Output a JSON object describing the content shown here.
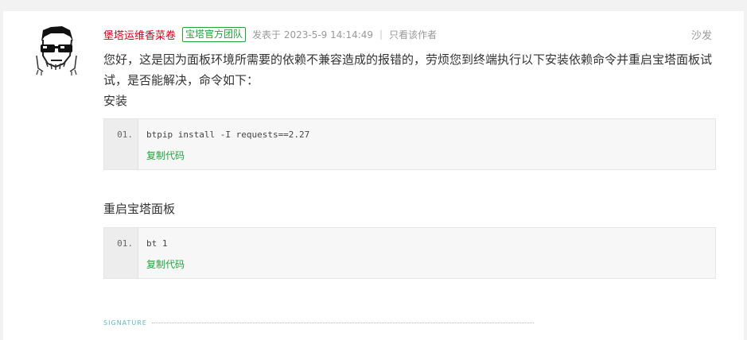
{
  "post": {
    "author": "堡塔运维香菜卷",
    "badge": "宝塔官方团队",
    "posted": "发表于 2023-5-9 14:14:49",
    "separator": "|",
    "only_author": "只看该作者",
    "floor": "沙发",
    "body": "您好，这是因为面板环境所需要的依赖不兼容造成的报错的，劳烦您到终端执行以下安装依赖命令并重启宝塔面板试试，是否能解决，命令如下：",
    "label_install": "安装",
    "label_restart": "重启宝塔面板",
    "code_blocks": [
      {
        "line_no": "01.",
        "code": "btpip install -I requests==2.27",
        "copy": "复制代码"
      },
      {
        "line_no": "01.",
        "code": "bt 1",
        "copy": "复制代码"
      }
    ],
    "signature": "SIGNATURE"
  },
  "colors": {
    "author": "#d9001b",
    "accent_green": "#20a53a",
    "signature": "#5fb8c9"
  },
  "icons": {
    "avatar": "avatar-sunglasses-face"
  }
}
